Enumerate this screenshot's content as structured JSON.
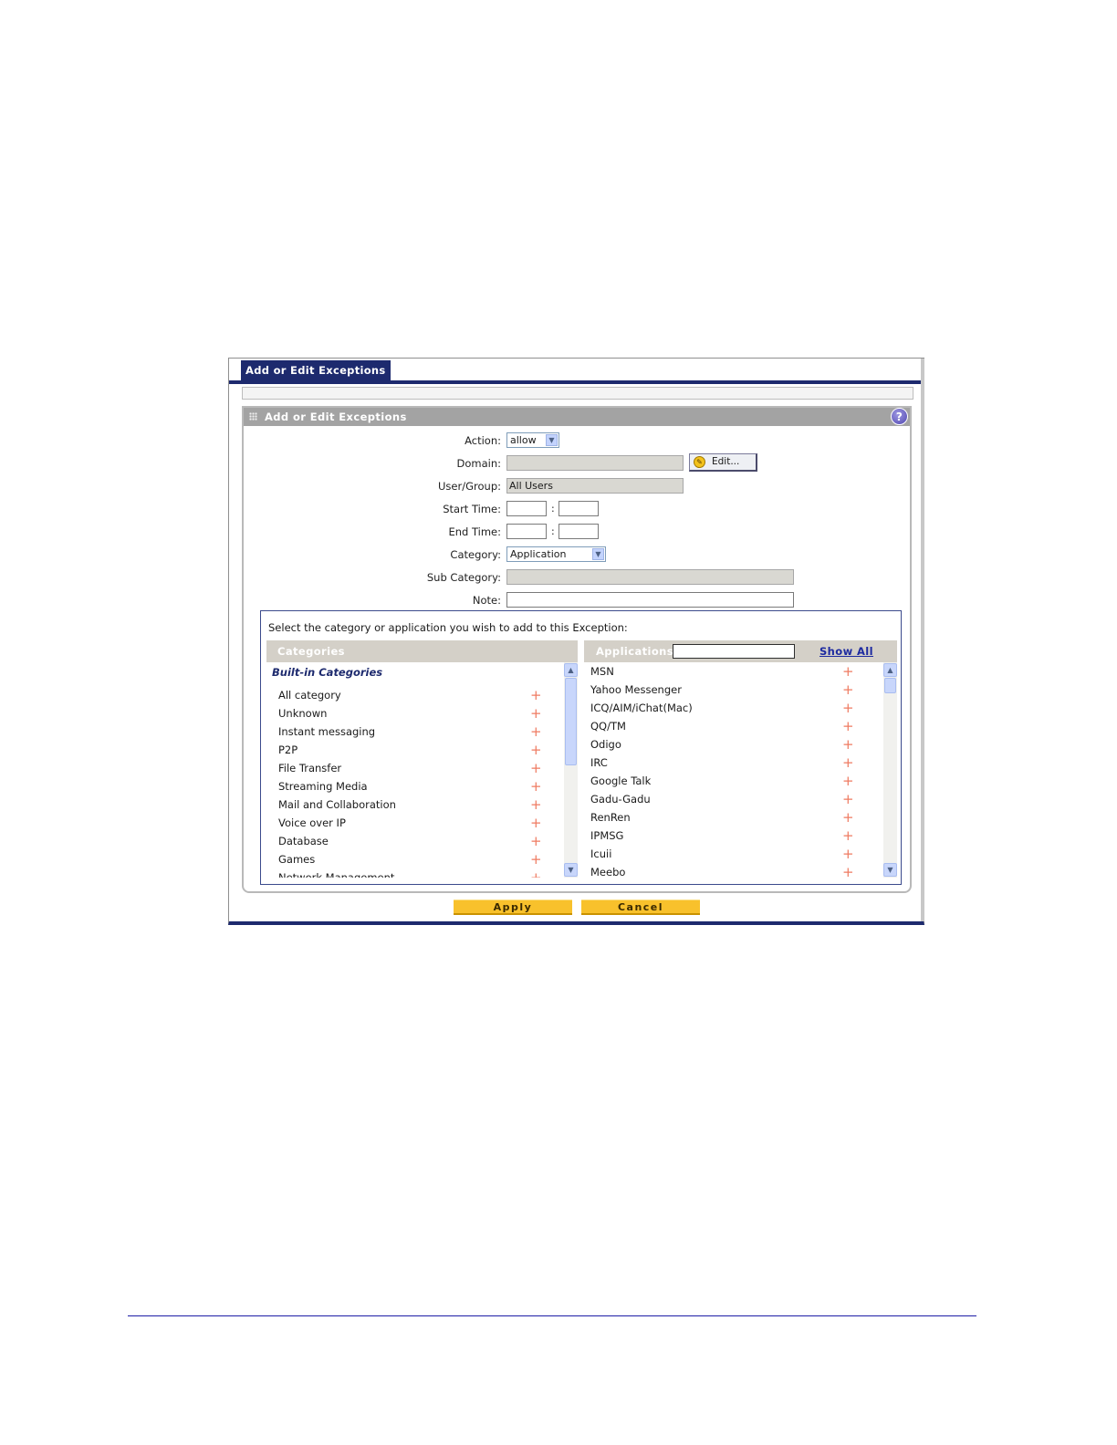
{
  "window": {
    "tab_title": "Add or Edit Exceptions"
  },
  "panel": {
    "title": "Add or Edit Exceptions",
    "help_icon": "?"
  },
  "form": {
    "action_label": "Action:",
    "action_value": "allow",
    "domain_label": "Domain:",
    "domain_value": "",
    "edit_button_label": "Edit...",
    "user_group_label": "User/Group:",
    "user_group_value": "All Users",
    "start_time_label": "Start Time:",
    "end_time_label": "End Time:",
    "time_separator": ":",
    "category_label": "Category:",
    "category_value": "Application",
    "sub_category_label": "Sub Category:",
    "sub_category_value": "",
    "note_label": "Note:",
    "note_value": ""
  },
  "selection": {
    "instruction": "Select the category or application you wish to add to this Exception:",
    "categories": {
      "header": "Categories",
      "group_title": "Built-in Categories",
      "items": [
        "All category",
        "Unknown",
        "Instant messaging",
        "P2P",
        "File Transfer",
        "Streaming Media",
        "Mail and Collaboration",
        "Voice over IP",
        "Database",
        "Games",
        "Network Management"
      ]
    },
    "applications": {
      "header": "Applications",
      "filter_value": "",
      "show_all_label": "Show All",
      "items": [
        "MSN",
        "Yahoo Messenger",
        "ICQ/AIM/iChat(Mac)",
        "QQ/TM",
        "Odigo",
        "IRC",
        "Google Talk",
        "Gadu-Gadu",
        "RenRen",
        "IPMSG",
        "Icuii",
        "Meebo"
      ]
    },
    "add_glyph": "+"
  },
  "buttons": {
    "apply_label": "Apply",
    "cancel_label": "Cancel"
  },
  "icons": {
    "scroll_up": "▲",
    "scroll_down": "▼",
    "select_arrow": "▼",
    "edit": "✎"
  }
}
